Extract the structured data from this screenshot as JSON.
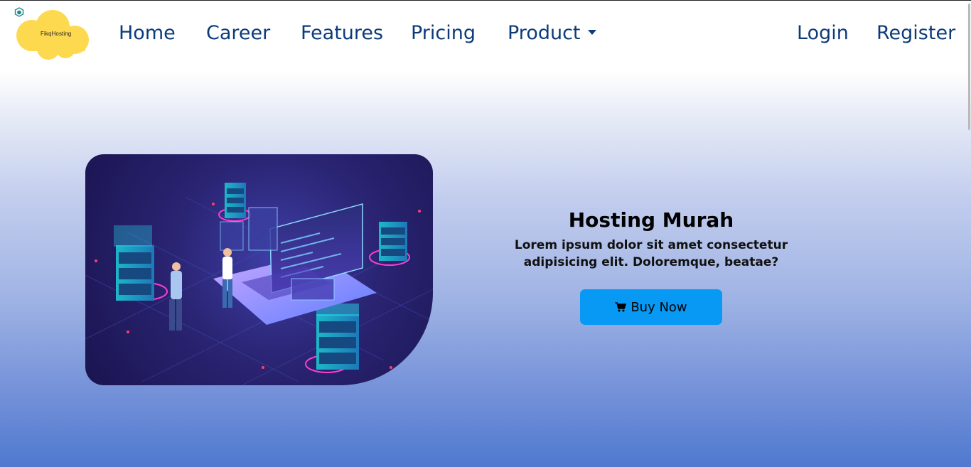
{
  "brand": {
    "name": "FikqHosting",
    "logo_icon": "hexagon-cube-icon",
    "logo_color": "#fdd94f"
  },
  "nav": {
    "links": [
      {
        "label": "Home"
      },
      {
        "label": "Career"
      },
      {
        "label": "Features"
      },
      {
        "label": "Pricing"
      },
      {
        "label": "Product",
        "icon": "caret-down-icon"
      }
    ],
    "auth": {
      "login": "Login",
      "register": "Register"
    },
    "text_color": "#0d3b7a"
  },
  "hero": {
    "title": "Hosting Murah",
    "description": "Lorem ipsum dolor sit amet consectetur adipisicing elit. Doloremque, beatae?",
    "button": {
      "label": "Buy Now",
      "icon": "shopping-cart-icon",
      "color": "#0899f5"
    },
    "image": "isometric-server-hosting-illustration"
  }
}
